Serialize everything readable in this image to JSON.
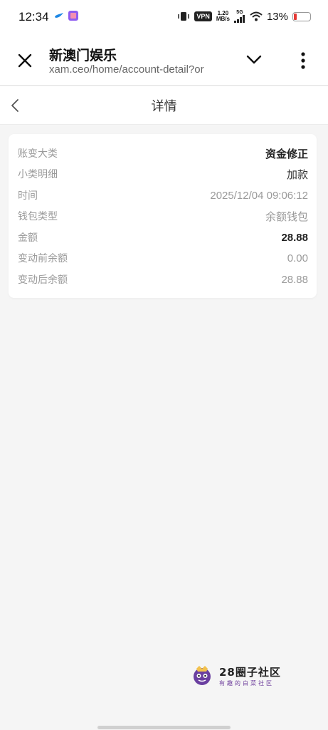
{
  "status_bar": {
    "time": "12:34",
    "vpn": "VPN",
    "speed_value": "1.20",
    "speed_unit": "MB/s",
    "network": "5G",
    "battery": "13%",
    "battery_color": "#e53935"
  },
  "browser": {
    "title": "新澳门娱乐",
    "url": "xam.ceo/home/account-detail?or"
  },
  "page": {
    "title": "详情"
  },
  "details": {
    "rows": [
      {
        "label": "账变大类",
        "value": "资金修正"
      },
      {
        "label": "小类明细",
        "value": "加款"
      },
      {
        "label": "时间",
        "value": "2025/12/04 09:06:12"
      },
      {
        "label": "钱包类型",
        "value": "余额钱包"
      },
      {
        "label": "金额",
        "value": "28.88"
      },
      {
        "label": "变动前余额",
        "value": "0.00"
      },
      {
        "label": "变动后余额",
        "value": "28.88"
      }
    ]
  },
  "watermark": {
    "title": "28圈子社区",
    "subtitle": "有趣的白菜社区"
  },
  "icons": {
    "close": "close-icon",
    "chevron": "chevron-down-icon",
    "more": "more-vertical-icon",
    "back": "back-arrow-icon"
  }
}
